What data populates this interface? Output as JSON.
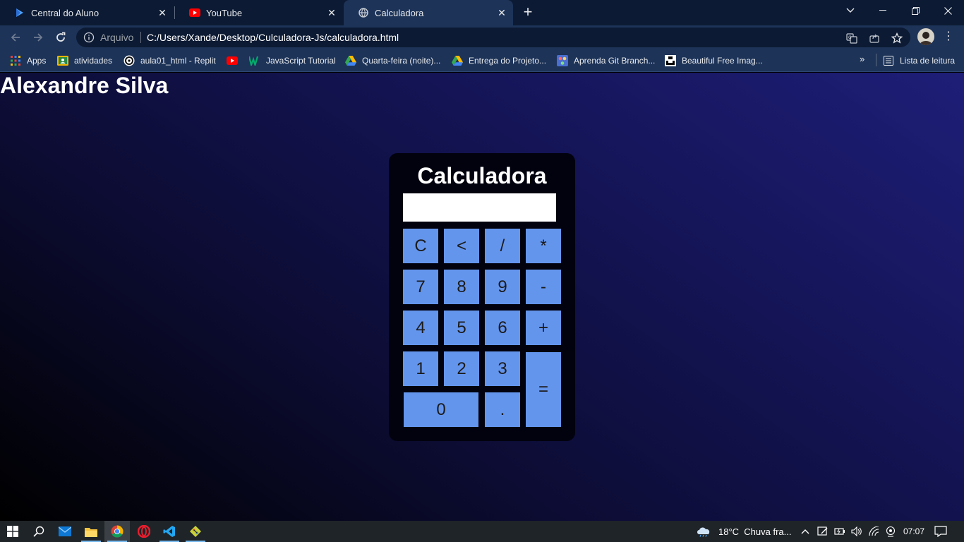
{
  "browser": {
    "tabs": [
      {
        "title": "Central do Aluno",
        "active": false
      },
      {
        "title": "YouTube",
        "active": false
      },
      {
        "title": "Calculadora",
        "active": true
      }
    ],
    "scheme_label": "Arquivo",
    "url": "C:/Users/Xande/Desktop/Culculadora-Js/calculadora.html",
    "bookmarks": [
      {
        "label": "Apps"
      },
      {
        "label": "atividades"
      },
      {
        "label": "aula01_html - Replit"
      },
      {
        "label": "JavaScript Tutorial"
      },
      {
        "label": "Quarta-feira (noite)..."
      },
      {
        "label": "Entrega do Projeto..."
      },
      {
        "label": "Aprenda Git Branch..."
      },
      {
        "label": "Beautiful Free Imag..."
      }
    ],
    "reading_list": "Lista de leitura",
    "colors": {
      "tabstrip": "#0c1a33",
      "toolbar": "#1d3358"
    }
  },
  "page": {
    "author": "Alexandre Silva",
    "calculator": {
      "title": "Calculadora",
      "display_value": "",
      "keys": {
        "clear": "C",
        "back": "<",
        "divide": "/",
        "multiply": "*",
        "seven": "7",
        "eight": "8",
        "nine": "9",
        "minus": "-",
        "four": "4",
        "five": "5",
        "six": "6",
        "plus": "+",
        "one": "1",
        "two": "2",
        "three": "3",
        "equals": "=",
        "zero": "0",
        "dot": "."
      },
      "colors": {
        "key": "#6495ed",
        "body": "#02020f",
        "display": "#ffffff"
      }
    }
  },
  "taskbar": {
    "weather": "18°C  Chuva fra...",
    "time": "07:07"
  }
}
